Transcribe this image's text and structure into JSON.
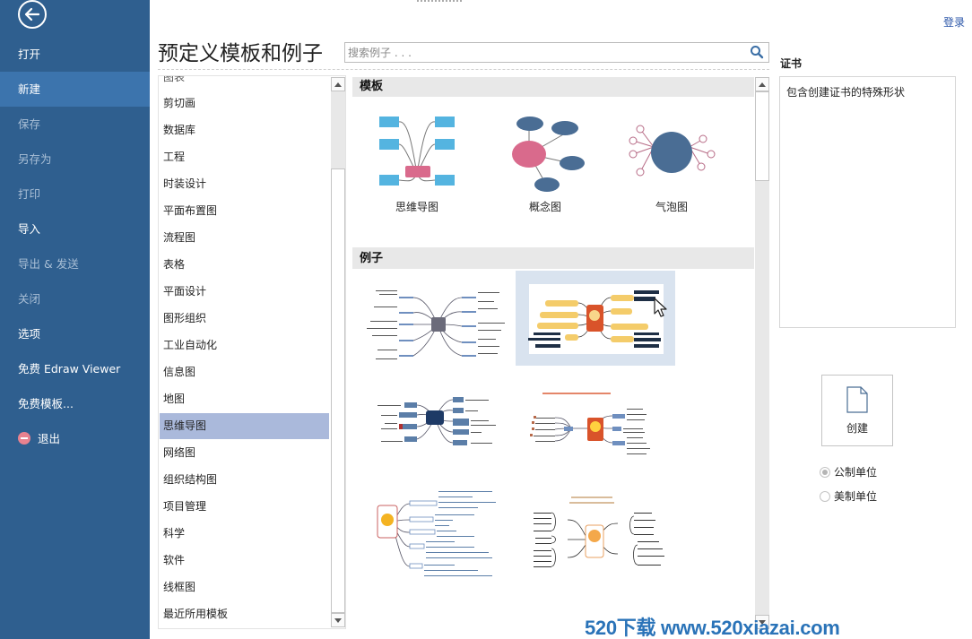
{
  "sidebar": {
    "back_icon": "arrow-left-circle-icon",
    "items": [
      {
        "label": "打开",
        "state": "normal"
      },
      {
        "label": "新建",
        "state": "active"
      },
      {
        "label": "保存",
        "state": "disabled"
      },
      {
        "label": "另存为",
        "state": "disabled"
      },
      {
        "label": "打印",
        "state": "disabled"
      },
      {
        "label": "导入",
        "state": "normal"
      },
      {
        "label": "导出 & 发送",
        "state": "disabled"
      },
      {
        "label": "关闭",
        "state": "disabled"
      },
      {
        "label": "选项",
        "state": "normal"
      },
      {
        "label": "免费 Edraw Viewer",
        "state": "normal"
      },
      {
        "label": "免费模板...",
        "state": "normal"
      },
      {
        "label": "退出",
        "state": "normal",
        "icon": "exit-icon"
      }
    ]
  },
  "header": {
    "login_label": "登录",
    "page_title": "预定义模板和例子",
    "search_placeholder": "搜索例子 . . ."
  },
  "categories": {
    "items": [
      "图表",
      "剪切画",
      "数据库",
      "工程",
      "时装设计",
      "平面布置图",
      "流程图",
      "表格",
      "平面设计",
      "图形组织",
      "工业自动化",
      "信息图",
      "地图",
      "思维导图",
      "网络图",
      "组织结构图",
      "项目管理",
      "科学",
      "软件",
      "线框图",
      "最近所用模板"
    ],
    "selected": "思维导图"
  },
  "gallery": {
    "templates_heading": "模板",
    "templates": [
      {
        "label": "思维导图",
        "icon": "mind-map-icon"
      },
      {
        "label": "概念图",
        "icon": "concept-map-icon"
      },
      {
        "label": "气泡图",
        "icon": "bubble-map-icon"
      }
    ],
    "examples_heading": "例子",
    "examples": [
      {
        "name": "example-mindmap-gray"
      },
      {
        "name": "example-mindmap-lightbulb",
        "hovered": true
      },
      {
        "name": "example-mindmap-navy"
      },
      {
        "name": "example-mindmap-ideas"
      },
      {
        "name": "example-mindmap-medal"
      },
      {
        "name": "example-mindmap-personality"
      }
    ]
  },
  "detail": {
    "title": "证书",
    "description": "包含创建证书的特殊形状",
    "create_label": "创建",
    "units": [
      {
        "label": "公制单位",
        "checked": true
      },
      {
        "label": "美制单位",
        "checked": false
      }
    ]
  },
  "watermark": "520下载 www.520xiazai.com",
  "colors": {
    "sidebar_bg": "#2f5f8f",
    "sidebar_active": "#3c74ad",
    "selected_category": "#aab9db",
    "accent_blue": "#4a6d94",
    "accent_pink": "#d96a8c"
  }
}
